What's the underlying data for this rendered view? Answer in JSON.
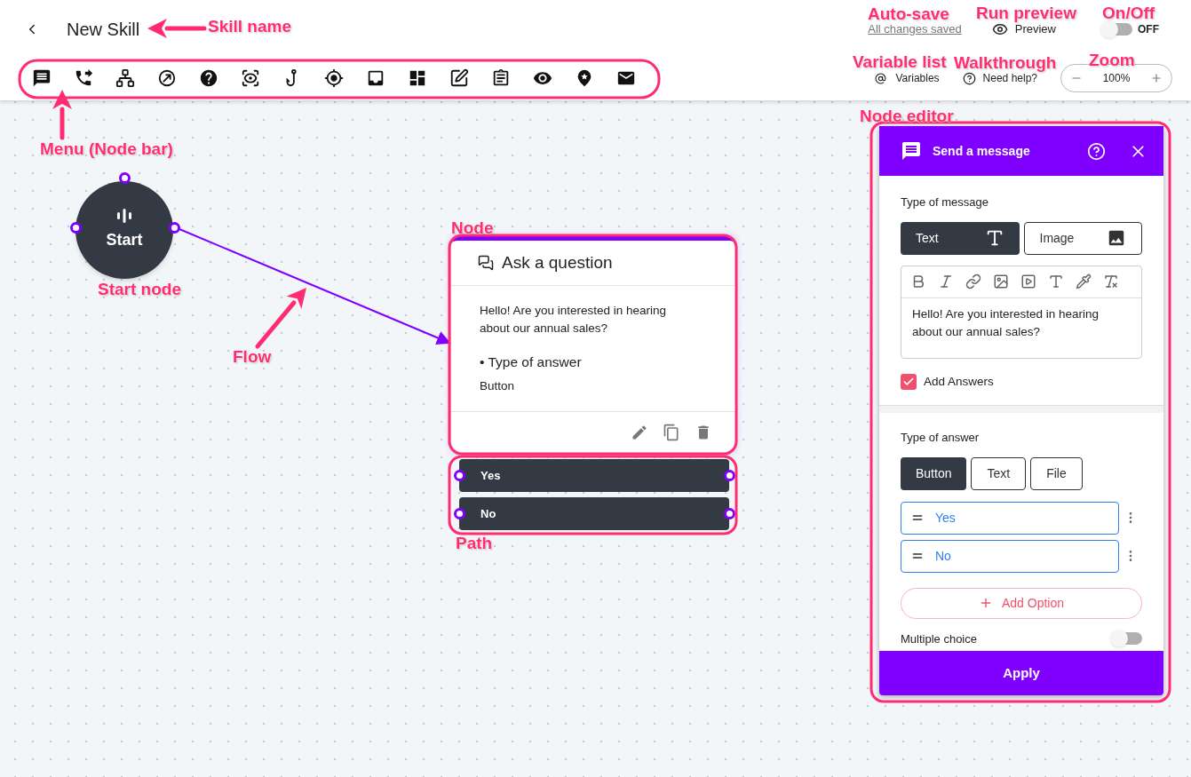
{
  "header": {
    "skill_name": "New Skill",
    "autosave": "All changes saved",
    "preview": "Preview",
    "power_toggle": {
      "label": "OFF",
      "on": false
    },
    "variables": "Variables",
    "help": "Need help?",
    "zoom": "100%"
  },
  "canvas": {
    "start_node": {
      "label": "Start"
    },
    "question_node": {
      "title": "Ask a question",
      "message": "Hello! Are you interested in hearing about our annual sales?",
      "answer_heading": "• Type of answer",
      "answer_type": "Button"
    },
    "paths": [
      {
        "label": "Yes"
      },
      {
        "label": "No"
      }
    ]
  },
  "editor": {
    "title": "Send a message",
    "message_type_label": "Type of message",
    "message_types": [
      {
        "label": "Text",
        "kind": "text",
        "selected": true
      },
      {
        "label": "Image",
        "kind": "image",
        "selected": false
      }
    ],
    "message": "Hello! Are you interested in hearing about our annual sales?",
    "add_answers": {
      "label": "Add Answers",
      "checked": true
    },
    "answer_type_label": "Type of answer",
    "answer_types": [
      {
        "label": "Button",
        "selected": true
      },
      {
        "label": "Text",
        "selected": false
      },
      {
        "label": "File",
        "selected": false
      }
    ],
    "options": [
      {
        "value": "Yes"
      },
      {
        "value": "No"
      }
    ],
    "add_option": "Add Option",
    "multiple_choice": {
      "label": "Multiple choice",
      "on": false
    },
    "apply": "Apply"
  },
  "annotations": [
    {
      "text": "Skill name"
    },
    {
      "text": "Auto-save"
    },
    {
      "text": "Run preview"
    },
    {
      "text": "On/Off"
    },
    {
      "text": "Variable list"
    },
    {
      "text": "Walkthrough"
    },
    {
      "text": "Zoom"
    },
    {
      "text": "Menu (Node bar)"
    },
    {
      "text": "Node editor"
    },
    {
      "text": "Node"
    },
    {
      "text": "Start node"
    },
    {
      "text": "Flow"
    },
    {
      "text": "Path"
    }
  ]
}
